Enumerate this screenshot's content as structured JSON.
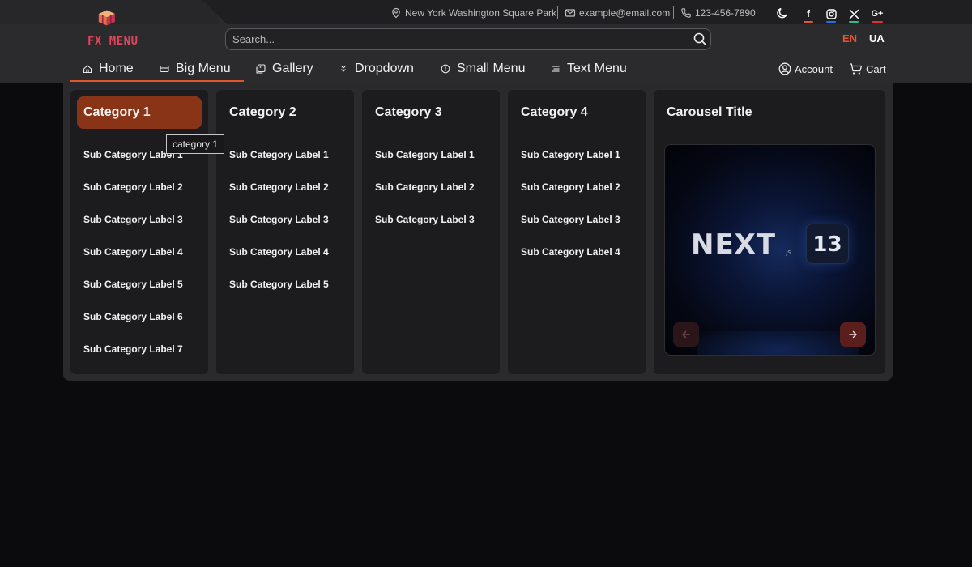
{
  "brand": {
    "logo_text": "FX MENU",
    "accent": "#e2562c",
    "logo_color": "#e0455b"
  },
  "contact": {
    "address": "New York Washington Square Park",
    "email": "example@email.com",
    "phone": "123-456-7890"
  },
  "social": [
    {
      "icon": "facebook-icon",
      "glyph": "f",
      "color": "#e2562c"
    },
    {
      "icon": "instagram-icon",
      "glyph": "◎",
      "color": "#2d6cdf"
    },
    {
      "icon": "x-twitter-icon",
      "glyph": "𝕏",
      "color": "#2dbd8c"
    },
    {
      "icon": "google-plus-icon",
      "glyph": "G+",
      "color": "#e02f3b"
    }
  ],
  "search": {
    "placeholder": "Search..."
  },
  "language": {
    "active": "EN",
    "other": "UA"
  },
  "nav": {
    "items": [
      {
        "label": "Home",
        "icon": "home-icon"
      },
      {
        "label": "Big Menu",
        "icon": "card-icon",
        "active": true
      },
      {
        "label": "Gallery",
        "icon": "gallery-icon"
      },
      {
        "label": "Dropdown",
        "icon": "chevrons-icon"
      },
      {
        "label": "Small Menu",
        "icon": "info-icon"
      },
      {
        "label": "Text Menu",
        "icon": "text-lines-icon"
      }
    ],
    "account_label": "Account",
    "cart_label": "Cart"
  },
  "mega_menu": {
    "categories": [
      {
        "title": "Category 1",
        "active": true,
        "items": [
          "Sub Category Label 1",
          "Sub Category Label 2",
          "Sub Category Label 3",
          "Sub Category Label 4",
          "Sub Category Label 5",
          "Sub Category Label 6",
          "Sub Category Label 7"
        ]
      },
      {
        "title": "Category 2",
        "items": [
          "Sub Category Label 1",
          "Sub Category Label 2",
          "Sub Category Label 3",
          "Sub Category Label 4",
          "Sub Category Label 5"
        ]
      },
      {
        "title": "Category 3",
        "items": [
          "Sub Category Label 1",
          "Sub Category Label 2",
          "Sub Category Label 3"
        ]
      },
      {
        "title": "Category 4",
        "items": [
          "Sub Category Label 1",
          "Sub Category Label 2",
          "Sub Category Label 3",
          "Sub Category Label 4"
        ]
      }
    ],
    "tooltip": "category 1",
    "carousel": {
      "title": "Carousel Title",
      "slide": {
        "word": "NEXT",
        "suffix": ".JS",
        "badge": "13"
      }
    }
  }
}
